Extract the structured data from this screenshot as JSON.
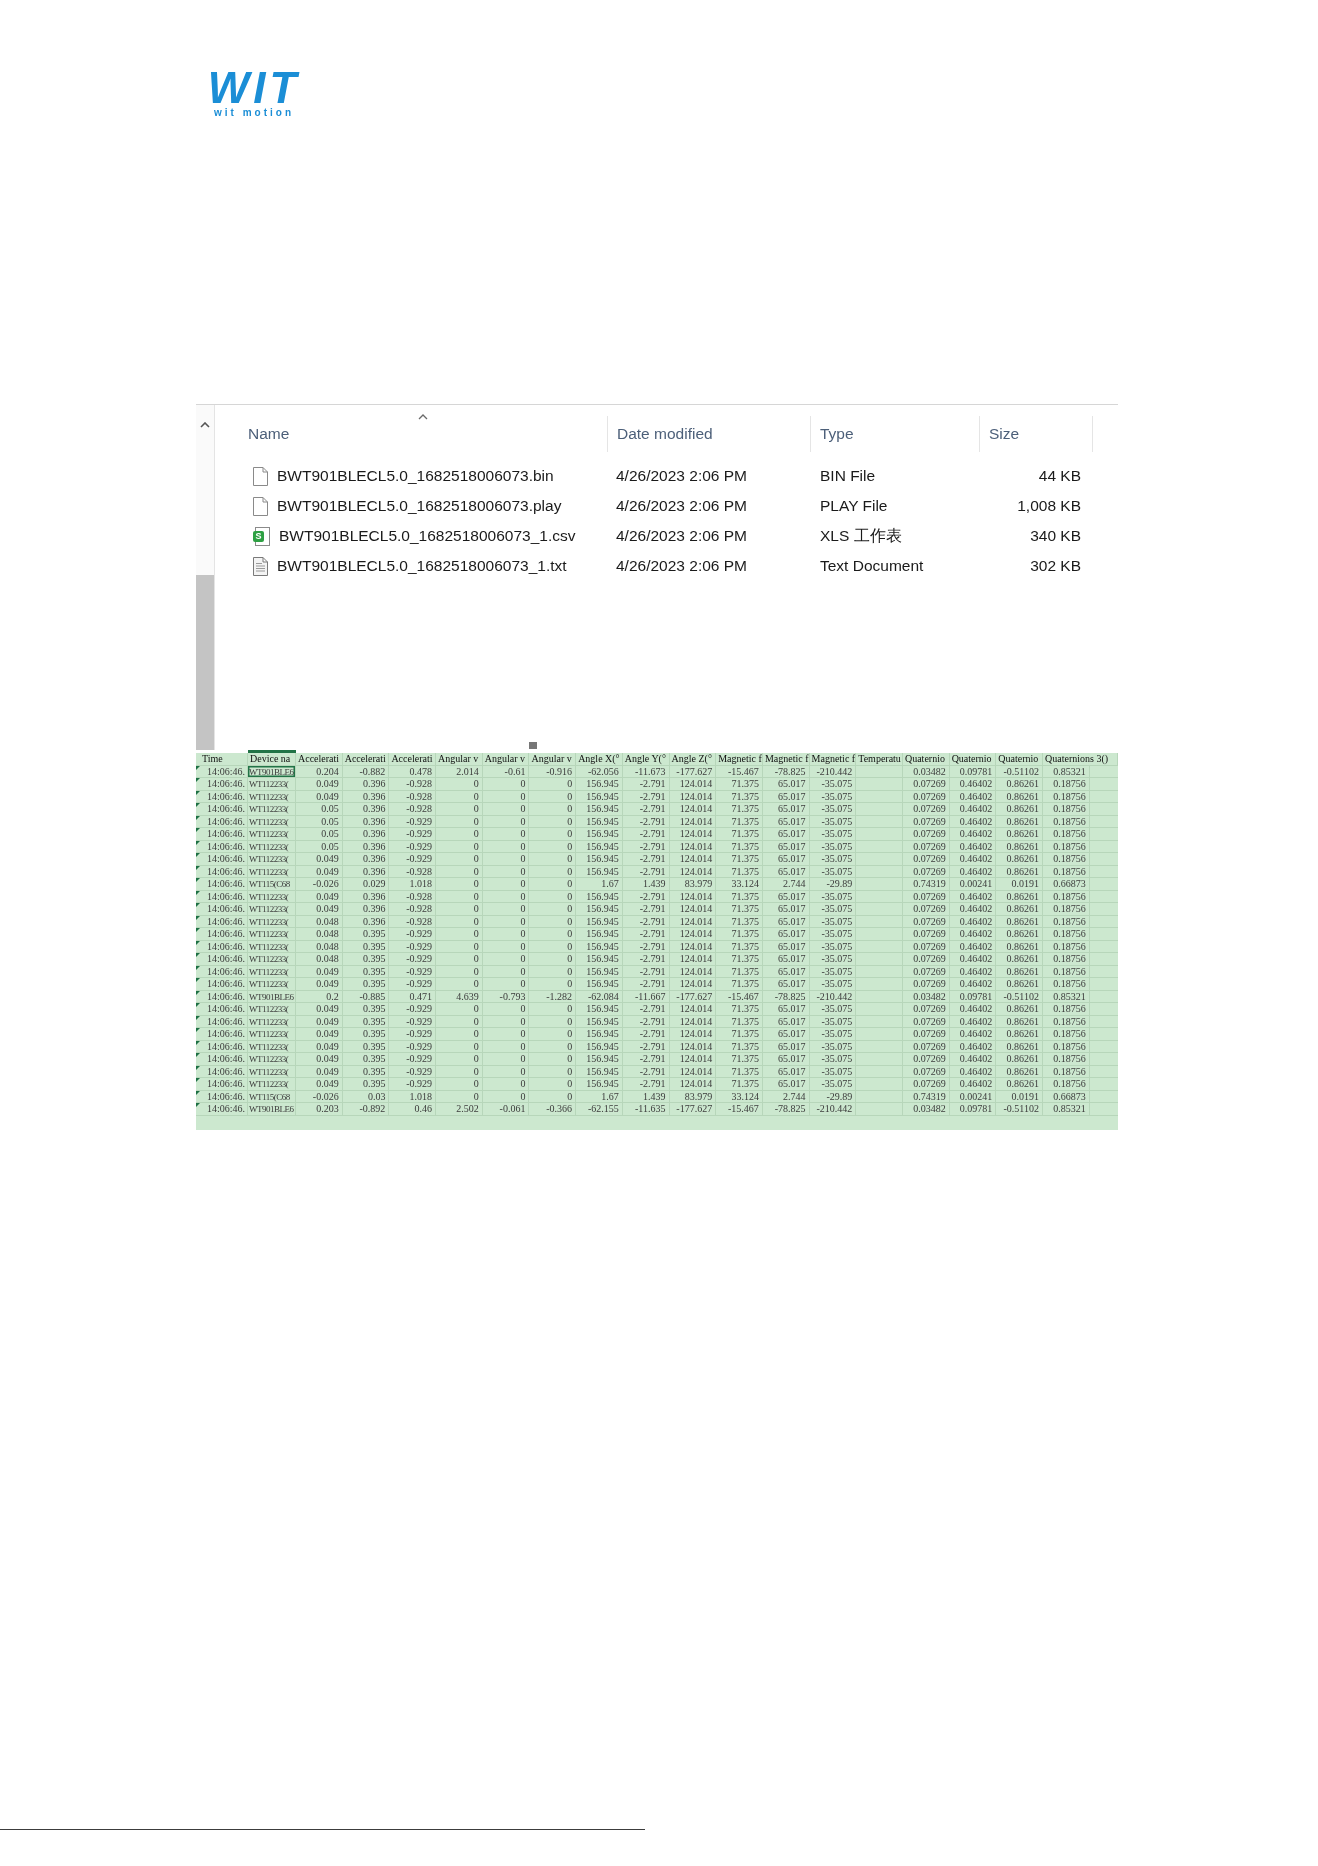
{
  "logo": {
    "mark": "WIT",
    "tagline": "wit motion"
  },
  "explorer": {
    "columns": [
      {
        "label": "Name",
        "sorted": true
      },
      {
        "label": "Date modified",
        "sorted": false
      },
      {
        "label": "Type",
        "sorted": false
      },
      {
        "label": "Size",
        "sorted": false
      }
    ],
    "files": [
      {
        "kind": "blank",
        "name": "BWT901BLECL5.0_1682518006073.bin",
        "date_modified": "4/26/2023 2:06 PM",
        "type": "BIN File",
        "size": "44 KB"
      },
      {
        "kind": "blank",
        "name": "BWT901BLECL5.0_1682518006073.play",
        "date_modified": "4/26/2023 2:06 PM",
        "type": "PLAY File",
        "size": "1,008 KB"
      },
      {
        "kind": "spreadsheet",
        "icon_letter": "S",
        "name": "BWT901BLECL5.0_1682518006073_1.csv",
        "date_modified": "4/26/2023 2:06 PM",
        "type": "XLS 工作表",
        "size": "340 KB"
      },
      {
        "kind": "text",
        "name": "BWT901BLECL5.0_1682518006073_1.txt",
        "date_modified": "4/26/2023 2:06 PM",
        "type": "Text Document",
        "size": "302 KB"
      }
    ]
  },
  "spreadsheet": {
    "columns": [
      {
        "label": "Time",
        "kind": "text",
        "selected": false
      },
      {
        "label": "Device na",
        "kind": "text",
        "selected": true
      },
      {
        "label": "Accelerati",
        "kind": "number",
        "selected": false
      },
      {
        "label": "Accelerati",
        "kind": "number",
        "selected": false
      },
      {
        "label": "Accelerati",
        "kind": "number",
        "selected": false
      },
      {
        "label": "Angular v",
        "kind": "number",
        "selected": false
      },
      {
        "label": "Angular v",
        "kind": "number",
        "selected": false
      },
      {
        "label": "Angular v",
        "kind": "number",
        "selected": false
      },
      {
        "label": "Angle X(°",
        "kind": "number",
        "selected": false
      },
      {
        "label": "Angle Y(°",
        "kind": "number",
        "selected": false
      },
      {
        "label": "Angle Z(°",
        "kind": "number",
        "selected": false
      },
      {
        "label": "Magnetic f",
        "kind": "number",
        "selected": false
      },
      {
        "label": "Magnetic f",
        "kind": "number",
        "selected": false
      },
      {
        "label": "Magnetic f",
        "kind": "number",
        "selected": false
      },
      {
        "label": "Temperatu",
        "kind": "number",
        "selected": false
      },
      {
        "label": "Quaternio",
        "kind": "number",
        "selected": false
      },
      {
        "label": "Quaternio",
        "kind": "number",
        "selected": false
      },
      {
        "label": "Quaternio",
        "kind": "number",
        "selected": false
      },
      {
        "label": "Quaternions 3()",
        "kind": "number",
        "selected": false
      }
    ],
    "rows": [
      {
        "flagged": true,
        "selected": true,
        "cells": [
          "14:06:46.",
          "WT901BLE6",
          "0.204",
          "-0.882",
          "0.478",
          "2.014",
          "-0.61",
          "-0.916",
          "-62.056",
          "-11.673",
          "-177.627",
          "-15.467",
          "-78.825",
          "-210.442",
          null,
          "0.03482",
          "0.09781",
          "-0.51102",
          "0.85321"
        ]
      },
      {
        "flagged": true,
        "selected": false,
        "cells": [
          "14:06:46.",
          "WT112233(",
          "0.049",
          "0.396",
          "-0.928",
          "0",
          "0",
          "0",
          "156.945",
          "-2.791",
          "124.014",
          "71.375",
          "65.017",
          "-35.075",
          null,
          "0.07269",
          "0.46402",
          "0.86261",
          "0.18756"
        ]
      },
      {
        "flagged": true,
        "selected": false,
        "cells": [
          "14:06:46.",
          "WT112233(",
          "0.049",
          "0.396",
          "-0.928",
          "0",
          "0",
          "0",
          "156.945",
          "-2.791",
          "124.014",
          "71.375",
          "65.017",
          "-35.075",
          null,
          "0.07269",
          "0.46402",
          "0.86261",
          "0.18756"
        ]
      },
      {
        "flagged": true,
        "selected": false,
        "cells": [
          "14:06:46.",
          "WT112233(",
          "0.05",
          "0.396",
          "-0.928",
          "0",
          "0",
          "0",
          "156.945",
          "-2.791",
          "124.014",
          "71.375",
          "65.017",
          "-35.075",
          null,
          "0.07269",
          "0.46402",
          "0.86261",
          "0.18756"
        ]
      },
      {
        "flagged": true,
        "selected": false,
        "cells": [
          "14:06:46.",
          "WT112233(",
          "0.05",
          "0.396",
          "-0.929",
          "0",
          "0",
          "0",
          "156.945",
          "-2.791",
          "124.014",
          "71.375",
          "65.017",
          "-35.075",
          null,
          "0.07269",
          "0.46402",
          "0.86261",
          "0.18756"
        ]
      },
      {
        "flagged": true,
        "selected": false,
        "cells": [
          "14:06:46.",
          "WT112233(",
          "0.05",
          "0.396",
          "-0.929",
          "0",
          "0",
          "0",
          "156.945",
          "-2.791",
          "124.014",
          "71.375",
          "65.017",
          "-35.075",
          null,
          "0.07269",
          "0.46402",
          "0.86261",
          "0.18756"
        ]
      },
      {
        "flagged": true,
        "selected": false,
        "cells": [
          "14:06:46.",
          "WT112233(",
          "0.05",
          "0.396",
          "-0.929",
          "0",
          "0",
          "0",
          "156.945",
          "-2.791",
          "124.014",
          "71.375",
          "65.017",
          "-35.075",
          null,
          "0.07269",
          "0.46402",
          "0.86261",
          "0.18756"
        ]
      },
      {
        "flagged": true,
        "selected": false,
        "cells": [
          "14:06:46.",
          "WT112233(",
          "0.049",
          "0.396",
          "-0.929",
          "0",
          "0",
          "0",
          "156.945",
          "-2.791",
          "124.014",
          "71.375",
          "65.017",
          "-35.075",
          null,
          "0.07269",
          "0.46402",
          "0.86261",
          "0.18756"
        ]
      },
      {
        "flagged": true,
        "selected": false,
        "cells": [
          "14:06:46.",
          "WT112233(",
          "0.049",
          "0.396",
          "-0.928",
          "0",
          "0",
          "0",
          "156.945",
          "-2.791",
          "124.014",
          "71.375",
          "65.017",
          "-35.075",
          null,
          "0.07269",
          "0.46402",
          "0.86261",
          "0.18756"
        ]
      },
      {
        "flagged": true,
        "selected": false,
        "cells": [
          "14:06:46.",
          "WT115(C68",
          "-0.026",
          "0.029",
          "1.018",
          "0",
          "0",
          "0",
          "1.67",
          "1.439",
          "83.979",
          "33.124",
          "2.744",
          "-29.89",
          null,
          "0.74319",
          "0.00241",
          "0.0191",
          "0.66873"
        ]
      },
      {
        "flagged": true,
        "selected": false,
        "cells": [
          "14:06:46.",
          "WT112233(",
          "0.049",
          "0.396",
          "-0.928",
          "0",
          "0",
          "0",
          "156.945",
          "-2.791",
          "124.014",
          "71.375",
          "65.017",
          "-35.075",
          null,
          "0.07269",
          "0.46402",
          "0.86261",
          "0.18756"
        ]
      },
      {
        "flagged": true,
        "selected": false,
        "cells": [
          "14:06:46.",
          "WT112233(",
          "0.049",
          "0.396",
          "-0.928",
          "0",
          "0",
          "0",
          "156.945",
          "-2.791",
          "124.014",
          "71.375",
          "65.017",
          "-35.075",
          null,
          "0.07269",
          "0.46402",
          "0.86261",
          "0.18756"
        ]
      },
      {
        "flagged": true,
        "selected": false,
        "cells": [
          "14:06:46.",
          "WT112233(",
          "0.048",
          "0.396",
          "-0.928",
          "0",
          "0",
          "0",
          "156.945",
          "-2.791",
          "124.014",
          "71.375",
          "65.017",
          "-35.075",
          null,
          "0.07269",
          "0.46402",
          "0.86261",
          "0.18756"
        ]
      },
      {
        "flagged": true,
        "selected": false,
        "cells": [
          "14:06:46.",
          "WT112233(",
          "0.048",
          "0.395",
          "-0.929",
          "0",
          "0",
          "0",
          "156.945",
          "-2.791",
          "124.014",
          "71.375",
          "65.017",
          "-35.075",
          null,
          "0.07269",
          "0.46402",
          "0.86261",
          "0.18756"
        ]
      },
      {
        "flagged": true,
        "selected": false,
        "cells": [
          "14:06:46.",
          "WT112233(",
          "0.048",
          "0.395",
          "-0.929",
          "0",
          "0",
          "0",
          "156.945",
          "-2.791",
          "124.014",
          "71.375",
          "65.017",
          "-35.075",
          null,
          "0.07269",
          "0.46402",
          "0.86261",
          "0.18756"
        ]
      },
      {
        "flagged": true,
        "selected": false,
        "cells": [
          "14:06:46.",
          "WT112233(",
          "0.048",
          "0.395",
          "-0.929",
          "0",
          "0",
          "0",
          "156.945",
          "-2.791",
          "124.014",
          "71.375",
          "65.017",
          "-35.075",
          null,
          "0.07269",
          "0.46402",
          "0.86261",
          "0.18756"
        ]
      },
      {
        "flagged": true,
        "selected": false,
        "cells": [
          "14:06:46.",
          "WT112233(",
          "0.049",
          "0.395",
          "-0.929",
          "0",
          "0",
          "0",
          "156.945",
          "-2.791",
          "124.014",
          "71.375",
          "65.017",
          "-35.075",
          null,
          "0.07269",
          "0.46402",
          "0.86261",
          "0.18756"
        ]
      },
      {
        "flagged": true,
        "selected": false,
        "cells": [
          "14:06:46.",
          "WT112233(",
          "0.049",
          "0.395",
          "-0.929",
          "0",
          "0",
          "0",
          "156.945",
          "-2.791",
          "124.014",
          "71.375",
          "65.017",
          "-35.075",
          null,
          "0.07269",
          "0.46402",
          "0.86261",
          "0.18756"
        ]
      },
      {
        "flagged": true,
        "selected": false,
        "cells": [
          "14:06:46.",
          "WT901BLE6",
          "0.2",
          "-0.885",
          "0.471",
          "4.639",
          "-0.793",
          "-1.282",
          "-62.084",
          "-11.667",
          "-177.627",
          "-15.467",
          "-78.825",
          "-210.442",
          null,
          "0.03482",
          "0.09781",
          "-0.51102",
          "0.85321"
        ]
      },
      {
        "flagged": true,
        "selected": false,
        "cells": [
          "14:06:46.",
          "WT112233(",
          "0.049",
          "0.395",
          "-0.929",
          "0",
          "0",
          "0",
          "156.945",
          "-2.791",
          "124.014",
          "71.375",
          "65.017",
          "-35.075",
          null,
          "0.07269",
          "0.46402",
          "0.86261",
          "0.18756"
        ]
      },
      {
        "flagged": true,
        "selected": false,
        "cells": [
          "14:06:46.",
          "WT112233(",
          "0.049",
          "0.395",
          "-0.929",
          "0",
          "0",
          "0",
          "156.945",
          "-2.791",
          "124.014",
          "71.375",
          "65.017",
          "-35.075",
          null,
          "0.07269",
          "0.46402",
          "0.86261",
          "0.18756"
        ]
      },
      {
        "flagged": true,
        "selected": false,
        "cells": [
          "14:06:46.",
          "WT112233(",
          "0.049",
          "0.395",
          "-0.929",
          "0",
          "0",
          "0",
          "156.945",
          "-2.791",
          "124.014",
          "71.375",
          "65.017",
          "-35.075",
          null,
          "0.07269",
          "0.46402",
          "0.86261",
          "0.18756"
        ]
      },
      {
        "flagged": true,
        "selected": false,
        "cells": [
          "14:06:46.",
          "WT112233(",
          "0.049",
          "0.395",
          "-0.929",
          "0",
          "0",
          "0",
          "156.945",
          "-2.791",
          "124.014",
          "71.375",
          "65.017",
          "-35.075",
          null,
          "0.07269",
          "0.46402",
          "0.86261",
          "0.18756"
        ]
      },
      {
        "flagged": true,
        "selected": false,
        "cells": [
          "14:06:46.",
          "WT112233(",
          "0.049",
          "0.395",
          "-0.929",
          "0",
          "0",
          "0",
          "156.945",
          "-2.791",
          "124.014",
          "71.375",
          "65.017",
          "-35.075",
          null,
          "0.07269",
          "0.46402",
          "0.86261",
          "0.18756"
        ]
      },
      {
        "flagged": true,
        "selected": false,
        "cells": [
          "14:06:46.",
          "WT112233(",
          "0.049",
          "0.395",
          "-0.929",
          "0",
          "0",
          "0",
          "156.945",
          "-2.791",
          "124.014",
          "71.375",
          "65.017",
          "-35.075",
          null,
          "0.07269",
          "0.46402",
          "0.86261",
          "0.18756"
        ]
      },
      {
        "flagged": true,
        "selected": false,
        "cells": [
          "14:06:46.",
          "WT112233(",
          "0.049",
          "0.395",
          "-0.929",
          "0",
          "0",
          "0",
          "156.945",
          "-2.791",
          "124.014",
          "71.375",
          "65.017",
          "-35.075",
          null,
          "0.07269",
          "0.46402",
          "0.86261",
          "0.18756"
        ]
      },
      {
        "flagged": true,
        "selected": false,
        "cells": [
          "14:06:46.",
          "WT115(C68",
          "-0.026",
          "0.03",
          "1.018",
          "0",
          "0",
          "0",
          "1.67",
          "1.439",
          "83.979",
          "33.124",
          "2.744",
          "-29.89",
          null,
          "0.74319",
          "0.00241",
          "0.0191",
          "0.66873"
        ]
      },
      {
        "flagged": true,
        "selected": false,
        "cells": [
          "14:06:46.",
          "WT901BLE6",
          "0.203",
          "-0.892",
          "0.46",
          "2.502",
          "-0.061",
          "-0.366",
          "-62.155",
          "-11.635",
          "-177.627",
          "-15.467",
          "-78.825",
          "-210.442",
          null,
          "0.03482",
          "0.09781",
          "-0.51102",
          "0.85321"
        ]
      }
    ]
  }
}
